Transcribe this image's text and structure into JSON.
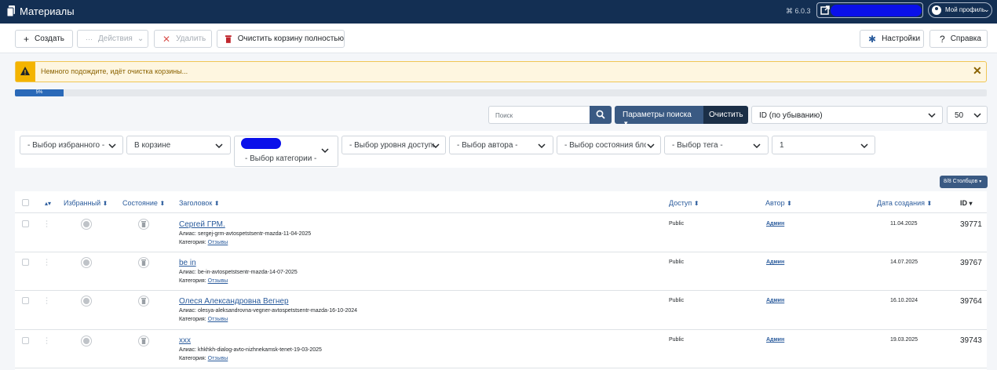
{
  "header": {
    "title": "Материалы",
    "version": "⌘ 6.0.3",
    "profile_label": "Мой профиль"
  },
  "toolbar": {
    "create": "Создать",
    "actions": "Действия",
    "delete": "Удалить",
    "empty_trash": "Очистить корзину полностью",
    "settings": "Настройки",
    "help": "Справка"
  },
  "alert": {
    "message": "Немного подождите, идёт очистка корзины..."
  },
  "progress": {
    "value_percent": 5,
    "label": "5%"
  },
  "search": {
    "placeholder": "Поиск",
    "params_label": "Параметры поиска",
    "clear_label": "Очистить",
    "sort_value": "ID (по убыванию)",
    "limit_value": "50"
  },
  "filters": {
    "featured": "- Выбор избранного -",
    "status": "В корзине",
    "category": "- Выбор категории -",
    "access": "- Выбор уровня доступа -",
    "author": "- Выбор автора -",
    "stage": "- Выбор состояния бло",
    "tag": "- Выбор тега -",
    "level": "1"
  },
  "columns_button": "8/8 Столбцов",
  "table": {
    "headers": {
      "featured": "Избранный",
      "status": "Состояние",
      "title": "Заголовок",
      "access": "Доступ",
      "author": "Автор",
      "created": "Дата создания",
      "id": "ID"
    },
    "alias_label": "Алиас:",
    "category_label": "Категория:",
    "rows": [
      {
        "title": "Сергей ГРМ.",
        "alias": "sergej-grm-avtospetstsentr-mazda-11-04-2025",
        "category": "Отзывы",
        "access": "Public",
        "author": "Админ",
        "date": "11.04.2025",
        "id": "39771"
      },
      {
        "title": "be in",
        "alias": "be-in-avtospetstsentr-mazda-14-07-2025",
        "category": "Отзывы",
        "access": "Public",
        "author": "Админ",
        "date": "14.07.2025",
        "id": "39767"
      },
      {
        "title": "Олеся Александровна Вегнер",
        "alias": "olesya-aleksandrovna-vegner-avtospetstsentr-mazda-16-10-2024",
        "category": "Отзывы",
        "access": "Public",
        "author": "Админ",
        "date": "16.10.2024",
        "id": "39764"
      },
      {
        "title": "xxx",
        "alias": "khkhkh-dialog-avto-nizhnekamsk-tenet-19-03-2025",
        "category": "Отзывы",
        "access": "Public",
        "author": "Админ",
        "date": "19.03.2025",
        "id": "39743"
      }
    ]
  }
}
